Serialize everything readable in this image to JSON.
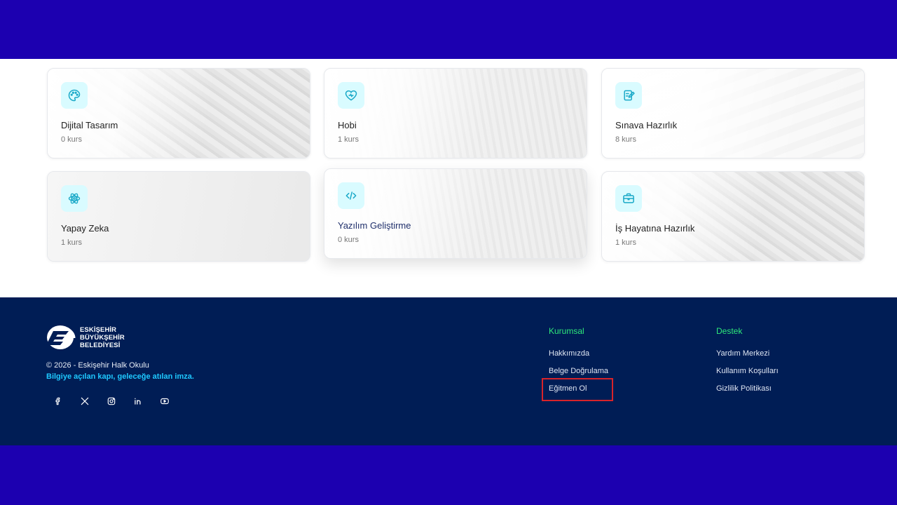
{
  "categories": [
    {
      "title": "Dijital Tasarım",
      "count": "0 kurs",
      "icon": "palette-icon"
    },
    {
      "title": "Hobi",
      "count": "1 kurs",
      "icon": "heart-icon"
    },
    {
      "title": "Sınava Hazırlık",
      "count": "8 kurs",
      "icon": "edit-note-icon"
    },
    {
      "title": "Yapay Zeka",
      "count": "1 kurs",
      "icon": "atom-icon"
    },
    {
      "title": "Yazılım Geliştirme",
      "count": "0 kurs",
      "icon": "code-icon"
    },
    {
      "title": "İş Hayatına Hazırlık",
      "count": "1 kurs",
      "icon": "briefcase-icon"
    }
  ],
  "footer": {
    "logo_lines": [
      "ESKİŞEHİR",
      "BÜYÜKŞEHİR",
      "BELEDİYESİ"
    ],
    "copyright": "© 2026 - Eskişehir Halk Okulu",
    "slogan": "Bilgiye açılan kapı, geleceğe atılan imza.",
    "socials": [
      "facebook-icon",
      "x-icon",
      "instagram-icon",
      "linkedin-icon",
      "youtube-icon"
    ],
    "kurumsal": {
      "title": "Kurumsal",
      "links": [
        "Hakkımızda",
        "Belge Doğrulama",
        "Eğitmen Ol"
      ]
    },
    "destek": {
      "title": "Destek",
      "links": [
        "Yardım Merkezi",
        "Kullanım Koşulları",
        "Gizlilik Politikası"
      ]
    }
  },
  "colors": {
    "frame": "#1c00b0",
    "footer_bg": "#001d55",
    "accent_cyan": "#1ec8ff",
    "column_title_green": "#2ee87a",
    "icon_bg": "#d9fbff",
    "highlight_red": "#d8242a"
  }
}
